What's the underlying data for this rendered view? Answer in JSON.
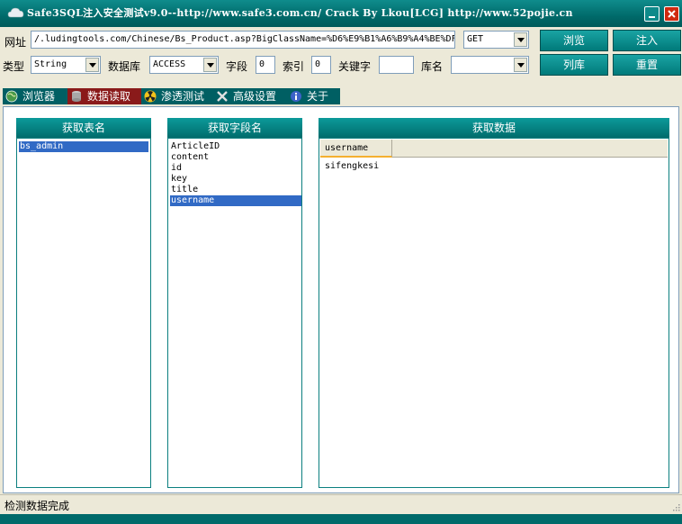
{
  "window": {
    "title": "Safe3SQL注入安全测试v9.0--http://www.safe3.com.cn/  Crack By Lkou[LCG]  http://www.52pojie.cn"
  },
  "toolbar": {
    "url_label": "网址",
    "url_value": "/.ludingtools.com/Chinese/Bs_Product.asp?BigClassName=%D6%E9%B1%A6%B9%A4%BE%DF",
    "method_value": "GET",
    "type_label": "类型",
    "type_value": "String",
    "db_label": "数据库",
    "db_value": "ACCESS",
    "field_label": "字段",
    "field_value": "0",
    "index_label": "索引",
    "index_value": "0",
    "keyword_label": "关键字",
    "keyword_value": "",
    "dbname_label": "库名",
    "dbname_value": "",
    "browse_label": "浏览",
    "inject_label": "注入",
    "listdb_label": "列库",
    "reset_label": "重置"
  },
  "tabs": [
    {
      "label": "浏览器",
      "icon": "globe-icon"
    },
    {
      "label": "数据读取",
      "icon": "database-icon"
    },
    {
      "label": "渗透测试",
      "icon": "radiation-icon"
    },
    {
      "label": "高级设置",
      "icon": "tools-icon"
    },
    {
      "label": "关于",
      "icon": "info-icon"
    }
  ],
  "tables_panel": {
    "header": "获取表名",
    "items": [
      "bs_admin"
    ]
  },
  "fields_panel": {
    "header": "获取字段名",
    "items": [
      "ArticleID",
      "content",
      "id",
      "key",
      "title",
      "username"
    ]
  },
  "data_panel": {
    "header": "获取数据",
    "columns": [
      "username"
    ],
    "rows": [
      [
        "sifengkesi"
      ]
    ]
  },
  "status": {
    "text": "检测数据完成"
  },
  "colors": {
    "accent": "#007a7a",
    "active_tab": "#8a1a1a",
    "selection": "#316ac5"
  }
}
